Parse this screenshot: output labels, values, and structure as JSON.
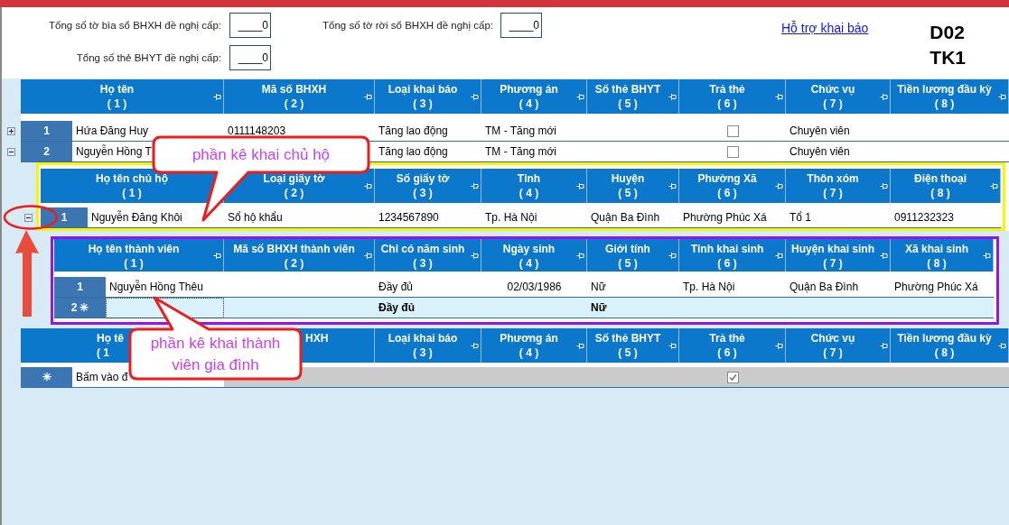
{
  "form": {
    "fields": [
      {
        "label": "Tổng số tờ bìa sổ BHXH đề nghị cấp:",
        "value": "____0"
      },
      {
        "label": "Tổng số tờ rời sổ BHXH đề nghị cấp:",
        "value": "____0"
      },
      {
        "label": "Tổng số thẻ BHYT đề nghị cấp:",
        "value": "____0"
      }
    ],
    "help_link": "Hỗ trợ khai báo",
    "form_code": [
      "D02",
      "TK1"
    ]
  },
  "employees": {
    "columns": [
      {
        "label": "Họ tên",
        "number": "( 1 )"
      },
      {
        "label": "Mã số BHXH",
        "number": "( 2 )"
      },
      {
        "label": "Loại khai báo",
        "number": "( 3 )"
      },
      {
        "label": "Phương án",
        "number": "( 4 )"
      },
      {
        "label": "Số thẻ BHYT",
        "number": "( 5 )"
      },
      {
        "label": "Trả thẻ",
        "number": "( 6 )"
      },
      {
        "label": "Chức vụ",
        "number": "( 7 )"
      },
      {
        "label": "Tiền lương đầu kỳ",
        "number": "( 8 )"
      }
    ],
    "rows": [
      {
        "number": "1",
        "expanded": false,
        "name": "Hứa Đăng Huy",
        "insurance_no": "0111148203",
        "declaration_type": "Tăng lao động",
        "plan": "TM - Tăng mới",
        "card_returned": false,
        "position": "Chuyên viên"
      },
      {
        "number": "2",
        "expanded": true,
        "name": "Nguyễn Hồng T",
        "declaration_type": "Tăng lao động",
        "plan": "TM - Tăng mới",
        "card_returned": false,
        "position": "Chuyên viên"
      }
    ]
  },
  "household": {
    "columns": [
      {
        "label": "Họ tên chủ hộ",
        "number": "( 1 )",
        "pin_covered": true
      },
      {
        "label": "Loại giấy tờ",
        "number": "( 2 )"
      },
      {
        "label": "Số giấy tờ",
        "number": "( 3 )"
      },
      {
        "label": "Tỉnh",
        "number": "( 4 )"
      },
      {
        "label": "Huyện",
        "number": "( 5 )"
      },
      {
        "label": "Phường Xã",
        "number": "( 6 )"
      },
      {
        "label": "Thôn xóm",
        "number": "( 7 )"
      },
      {
        "label": "Điện thoại",
        "number": "( 8 )"
      }
    ],
    "rows": [
      {
        "number": "1",
        "expanded": true,
        "name": "Nguyễn Đăng Khôi",
        "document_type": "Sổ hộ khẩu",
        "document_no": "1234567890",
        "province": "Tp. Hà Nội",
        "district": "Quận Ba Đình",
        "ward": "Phường Phúc Xá",
        "hamlet": "Tổ 1",
        "phone": "0911232323"
      }
    ]
  },
  "members": {
    "columns": [
      {
        "label": "Họ tên thành viên",
        "number": "( 1 )"
      },
      {
        "label": "Mã số BHXH thành viên",
        "number": "( 2 )"
      },
      {
        "label": "Chỉ có năm sinh",
        "number": "( 3 )"
      },
      {
        "label": "Ngày sinh",
        "number": "( 4 )"
      },
      {
        "label": "Giới tính",
        "number": "( 5 )"
      },
      {
        "label": "Tỉnh khai sinh",
        "number": "( 6 )"
      },
      {
        "label": "Huyện khai sinh",
        "number": "( 7 )"
      },
      {
        "label": "Xã khai sinh",
        "number": "( 8 )"
      }
    ],
    "rows": [
      {
        "kind": "data",
        "number": "1",
        "name": "Nguyễn Hồng Thêu",
        "birth_year_only": "Đầy đủ",
        "birth_date": "02/03/1986",
        "gender": "Nữ",
        "birth_province": "Tp. Hà Nội",
        "birth_district": "Quận Ba Đình",
        "birth_commune": "Phường Phúc Xá"
      },
      {
        "kind": "new",
        "number": "2",
        "marker": "✳",
        "birth_year_only": "Đầy đủ",
        "gender": "Nữ"
      }
    ]
  },
  "employees_footer": {
    "columns": [
      {
        "label": "Họ tê",
        "number": "( 1",
        "covered": true
      },
      {
        "label": "HXH",
        "covered": true
      },
      {
        "label": "Loại khai báo",
        "number": "( 3 )",
        "covered": false
      },
      {
        "label": "Phương án",
        "number": "( 4 )",
        "covered": false
      },
      {
        "label": "Số thẻ BHYT",
        "number": "( 5 )",
        "covered": false
      },
      {
        "label": "Trả thẻ",
        "number": "( 6 )",
        "covered": false
      },
      {
        "label": "Chức vụ",
        "number": "( 7 )",
        "covered": false
      },
      {
        "label": "Tiền lương đầu kỳ",
        "number": "( 8 )",
        "covered": false
      }
    ],
    "rows": [
      {
        "kind": "append",
        "marker": "✳",
        "name": "Bấm vào đ",
        "card_returned": true
      }
    ]
  },
  "annotations": [
    {
      "text": "phần kê khai chủ hộ"
    },
    {
      "text": "phần kê khai thành viên gia đình"
    }
  ]
}
